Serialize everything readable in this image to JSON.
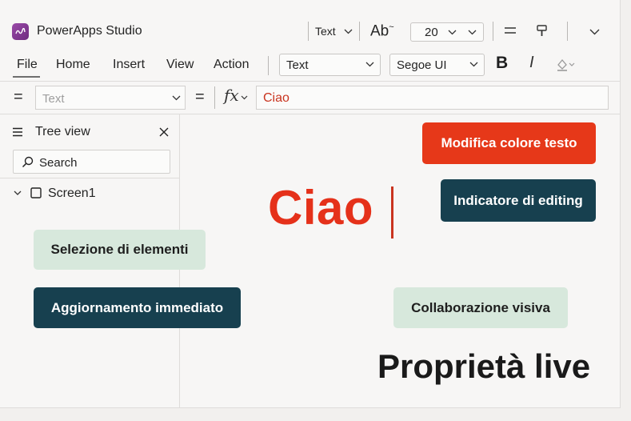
{
  "app": {
    "title": "PowerApps Studio"
  },
  "toolbar": {
    "control_type": "Text",
    "ab_label": "Ab",
    "font_size": "20"
  },
  "menu": {
    "items": [
      {
        "label": "File"
      },
      {
        "label": "Home"
      },
      {
        "label": "Insert"
      },
      {
        "label": "View"
      },
      {
        "label": "Action"
      }
    ],
    "control_dropdown": "Text",
    "font_dropdown": "Segoe UI",
    "bold_label": "B",
    "italic_label": "I"
  },
  "formula_bar": {
    "property": "Text",
    "fx_label": "fx",
    "formula": "Ciao"
  },
  "tree_view": {
    "title": "Tree view",
    "search_placeholder": "Search",
    "items": [
      {
        "label": "Screen1"
      }
    ]
  },
  "canvas": {
    "label_text": "Ciao",
    "callouts": {
      "modifica_colore": "Modifica colore testo",
      "indicatore_editing": "Indicatore di editing",
      "selezione_elementi": "Selezione di elementi",
      "aggiornamento": "Aggiornamento immediato",
      "collaborazione": "Collaborazione visiva",
      "proprieta_live": "Proprietà live"
    }
  },
  "colors": {
    "accent_red": "#e5311a",
    "callout_dark": "#17404f",
    "callout_light": "#d7e8dc",
    "app_logo": "#8a3a99"
  }
}
